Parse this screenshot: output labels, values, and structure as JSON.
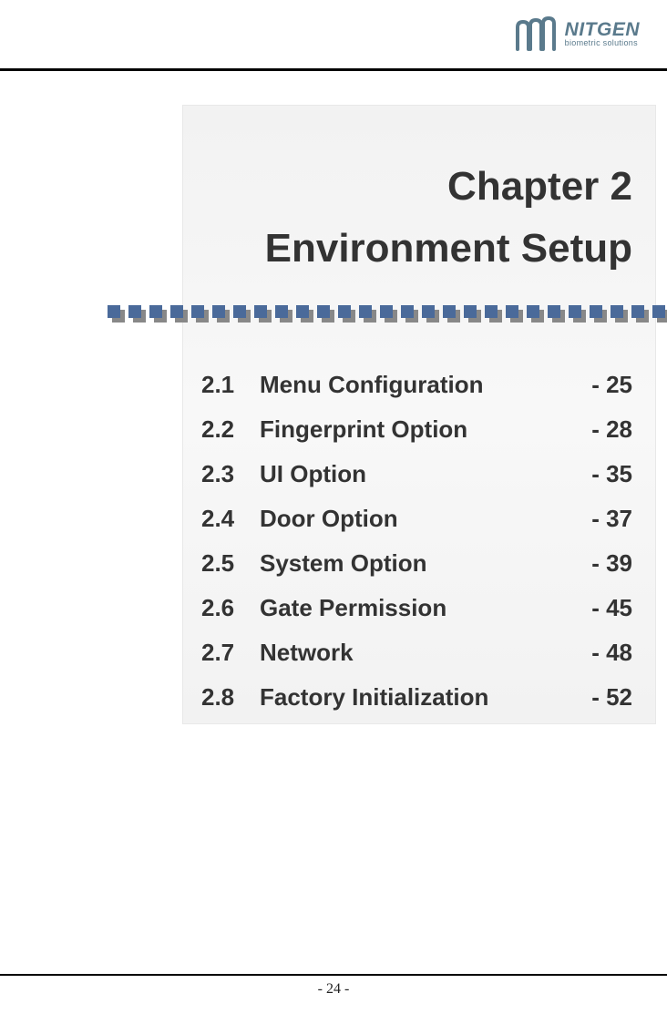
{
  "logo": {
    "name": "NITGEN",
    "tagline": "biometric solutions"
  },
  "chapter": {
    "line1": "Chapter 2",
    "line2": "Environment Setup"
  },
  "toc": [
    {
      "num": "2.1",
      "title": "Menu Configuration",
      "page": "- 25"
    },
    {
      "num": "2.2",
      "title": "Fingerprint Option",
      "page": "- 28"
    },
    {
      "num": "2.3",
      "title": "UI Option",
      "page": "- 35"
    },
    {
      "num": "2.4",
      "title": "Door Option",
      "page": "- 37"
    },
    {
      "num": "2.5",
      "title": "System Option",
      "page": "- 39"
    },
    {
      "num": "2.6",
      "title": "Gate Permission",
      "page": "- 45"
    },
    {
      "num": "2.7",
      "title": "Network",
      "page": "- 48"
    },
    {
      "num": "2.8",
      "title": "Factory Initialization",
      "page": "- 52"
    }
  ],
  "footer": {
    "page_number": "- 24 -"
  }
}
